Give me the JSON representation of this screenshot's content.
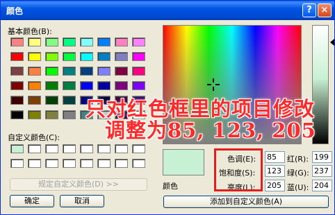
{
  "window": {
    "title": "颜色",
    "help_button": "?",
    "close_button": "×"
  },
  "basic_colors": {
    "label": "基本颜色(B):",
    "swatches": [
      "#ff8080",
      "#ffff80",
      "#80ff80",
      "#00ff80",
      "#80ffff",
      "#0080ff",
      "#ff80c0",
      "#ff80ff",
      "#ff0000",
      "#ffff00",
      "#80ff00",
      "#00ff40",
      "#00ffff",
      "#0080c0",
      "#8080c0",
      "#ff00ff",
      "#804040",
      "#ff8040",
      "#00ff00",
      "#008080",
      "#004080",
      "#8080ff",
      "#800040",
      "#ff0080",
      "#800000",
      "#ff8000",
      "#008000",
      "#008040",
      "#0000ff",
      "#0000a0",
      "#800080",
      "#8000ff",
      "#400000",
      "#804000",
      "#004000",
      "#004040",
      "#000080",
      "#000040",
      "#400040",
      "#400080",
      "#000000",
      "#808000",
      "#808040",
      "#808080",
      "#408080",
      "#c0c0c0",
      "#400040",
      "#ffffff"
    ]
  },
  "custom_colors": {
    "label": "自定义颜色(C):",
    "swatches": [
      "#c8f0d2",
      "#ffffff",
      "#ffffff",
      "#ffffff",
      "#ffffff",
      "#ffffff",
      "#ffffff",
      "#ffffff",
      "#ffffff",
      "#ffffff",
      "#ffffff",
      "#ffffff",
      "#ffffff",
      "#ffffff",
      "#ffffff",
      "#ffffff"
    ]
  },
  "buttons": {
    "define_custom": "规定自定义颜色(D) >>",
    "ok": "确定",
    "cancel": "取消",
    "add_custom": "添加到自定义颜色(A)"
  },
  "preview": {
    "label": "颜色",
    "color": "#c8f0d2"
  },
  "fields": {
    "hue_label": "色调(E):",
    "hue_value": "85",
    "sat_label": "饱和度(S):",
    "sat_value": "123",
    "lum_label": "亮度(L):",
    "lum_value": "205",
    "red_label": "红(R):",
    "red_value": "199",
    "green_label": "绿(G):",
    "green_value": "237",
    "blue_label": "蓝(U):",
    "blue_value": "204"
  },
  "annotation": {
    "line1": "只对红色框里的项目修改",
    "line2": "调整为85, 123, 205",
    "highlight_color": "#e41c1c"
  }
}
